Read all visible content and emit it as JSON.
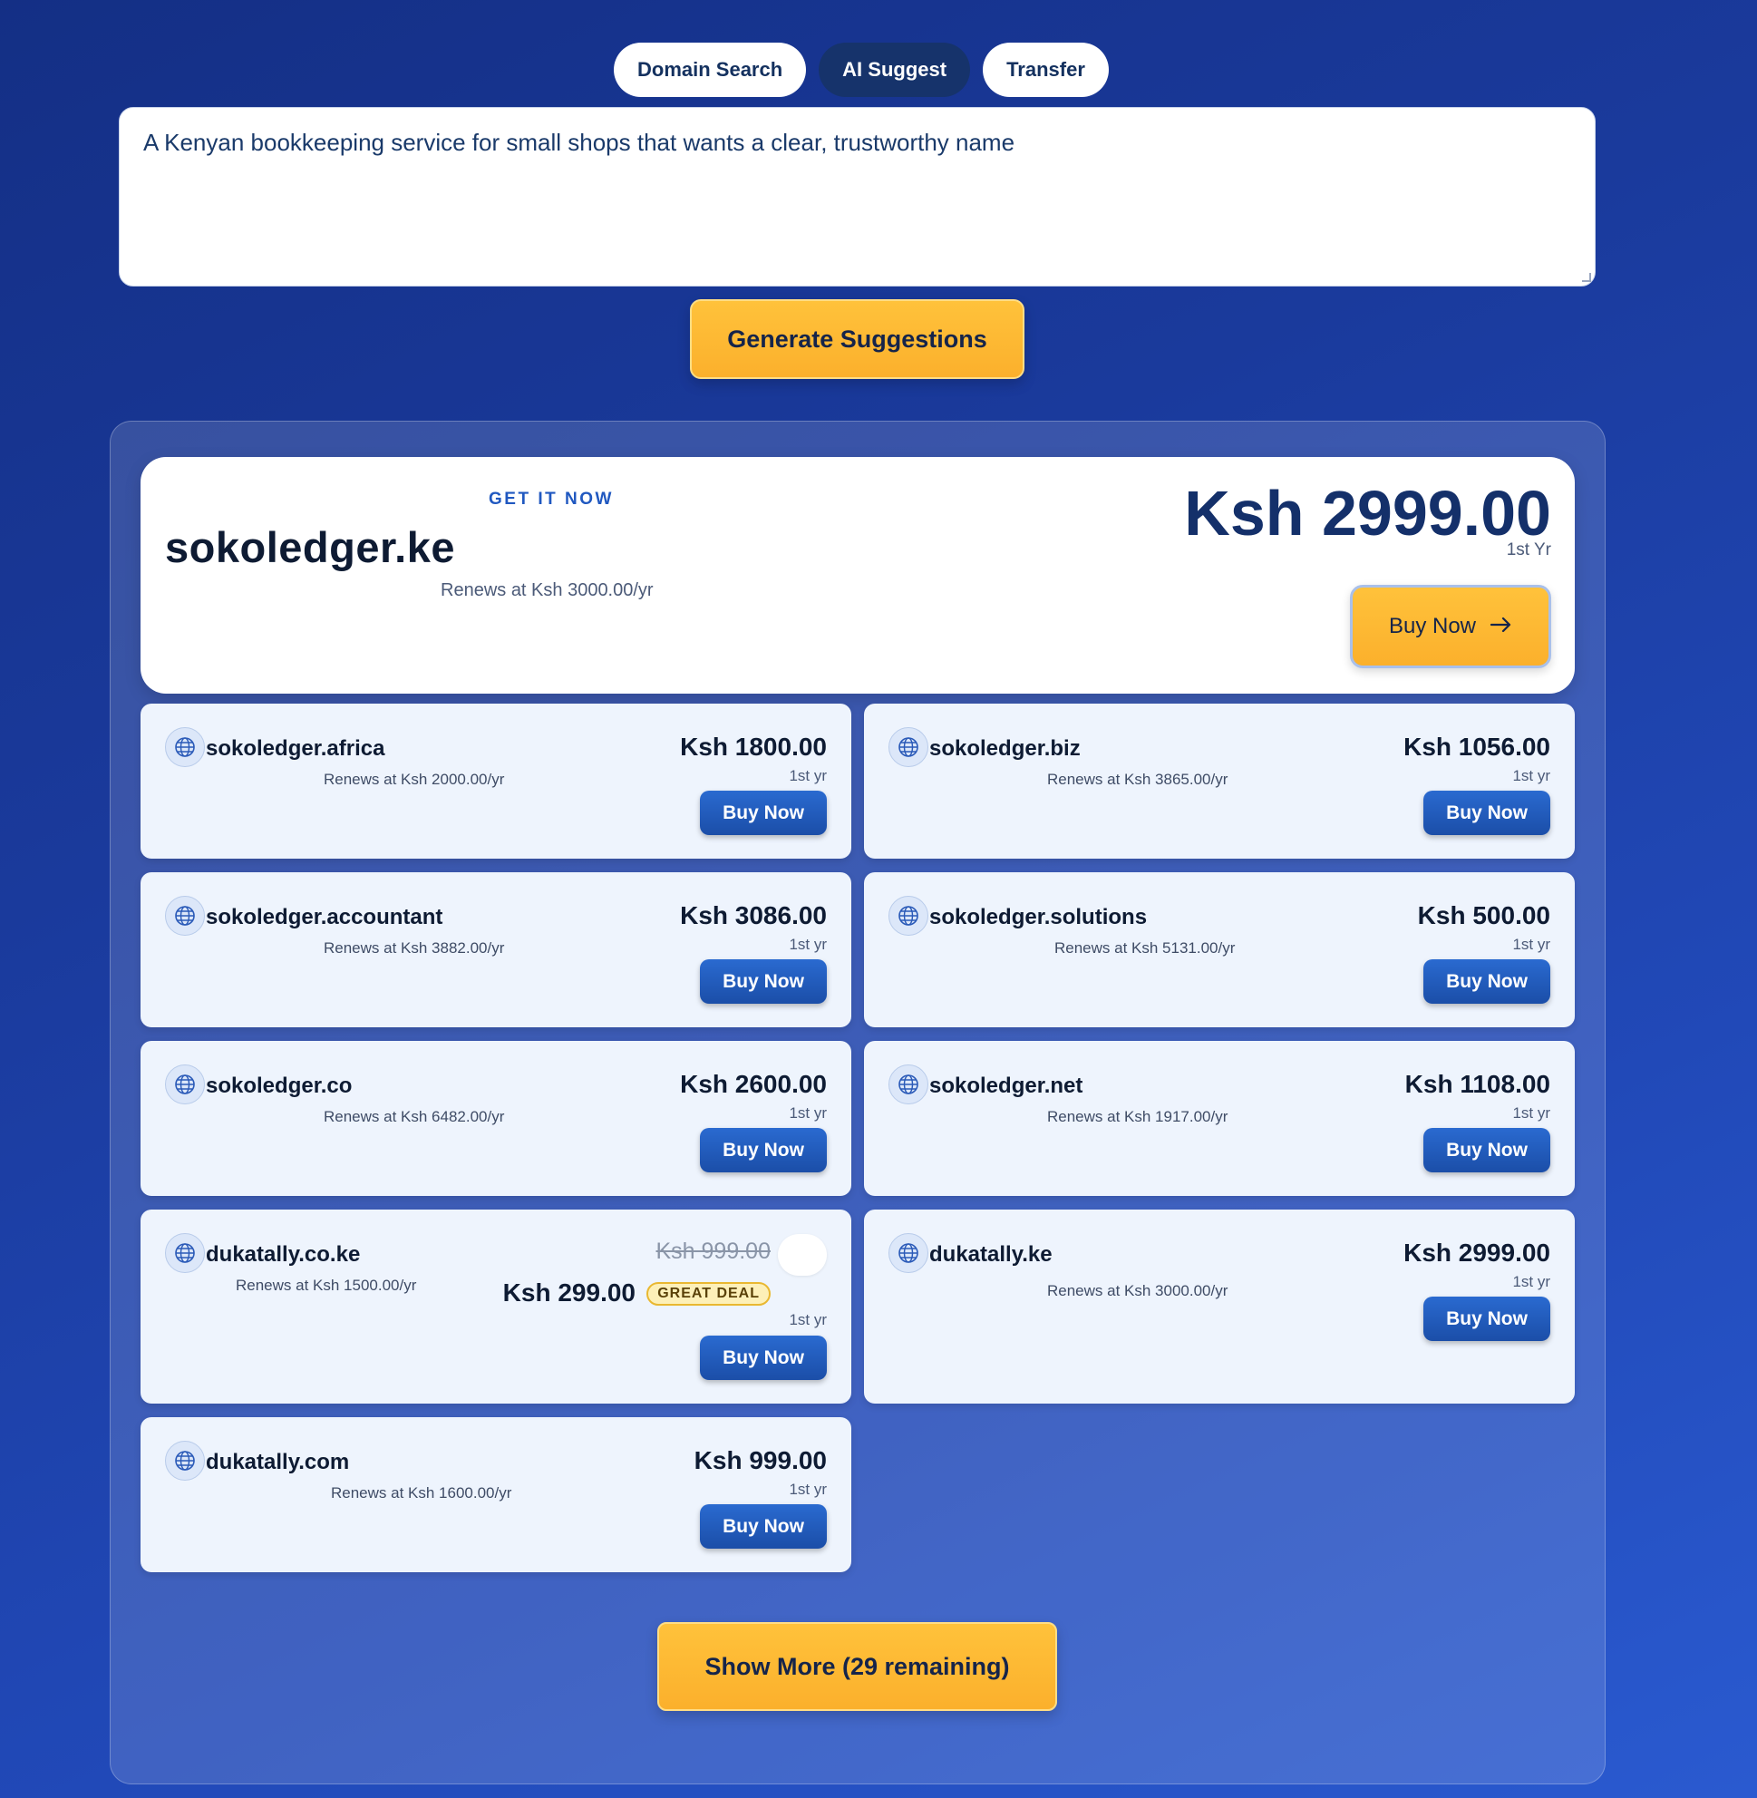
{
  "tabs": [
    {
      "label": "Domain Search",
      "active": false
    },
    {
      "label": "AI Suggest",
      "active": true
    },
    {
      "label": "Transfer",
      "active": false
    }
  ],
  "prompt": {
    "value": "A Kenyan bookkeeping service for small shops that wants a clear, trustworthy name"
  },
  "generate_label": "Generate Suggestions",
  "featured": {
    "tag": "GET IT NOW",
    "domain": "sokoledger.ke",
    "renew": "Renews at Ksh 3000.00/yr",
    "price": "Ksh 2999.00",
    "period": "1st Yr",
    "buy_label": "Buy Now"
  },
  "results": [
    {
      "domain": "sokoledger.africa",
      "renew": "Renews at Ksh 2000.00/yr",
      "price": "Ksh 1800.00",
      "period": "1st yr",
      "buy_label": "Buy Now"
    },
    {
      "domain": "sokoledger.biz",
      "renew": "Renews at Ksh 3865.00/yr",
      "price": "Ksh 1056.00",
      "period": "1st yr",
      "buy_label": "Buy Now"
    },
    {
      "domain": "sokoledger.accountant",
      "renew": "Renews at Ksh 3882.00/yr",
      "price": "Ksh 3086.00",
      "period": "1st yr",
      "buy_label": "Buy Now"
    },
    {
      "domain": "sokoledger.solutions",
      "renew": "Renews at Ksh 5131.00/yr",
      "price": "Ksh 500.00",
      "period": "1st yr",
      "buy_label": "Buy Now"
    },
    {
      "domain": "sokoledger.co",
      "renew": "Renews at Ksh 6482.00/yr",
      "price": "Ksh 2600.00",
      "period": "1st yr",
      "buy_label": "Buy Now"
    },
    {
      "domain": "sokoledger.net",
      "renew": "Renews at Ksh 1917.00/yr",
      "price": "Ksh 1108.00",
      "period": "1st yr",
      "buy_label": "Buy Now"
    },
    {
      "domain": "dukatally.co.ke",
      "renew": "Renews at Ksh 1500.00/yr",
      "original_price": "Ksh 999.00",
      "price": "Ksh 299.00",
      "badge": "GREAT DEAL",
      "period": "1st yr",
      "buy_label": "Buy Now"
    },
    {
      "domain": "dukatally.ke",
      "renew": "Renews at Ksh 3000.00/yr",
      "price": "Ksh 2999.00",
      "period": "1st yr",
      "buy_label": "Buy Now"
    },
    {
      "domain": "dukatally.com",
      "renew": "Renews at Ksh 1600.00/yr",
      "price": "Ksh 999.00",
      "period": "1st yr",
      "buy_label": "Buy Now"
    }
  ],
  "show_more_label": "Show More (29 remaining)",
  "colors": {
    "accent": "#fbb02c",
    "primary": "#1b4ea8",
    "dark": "#16336b"
  }
}
